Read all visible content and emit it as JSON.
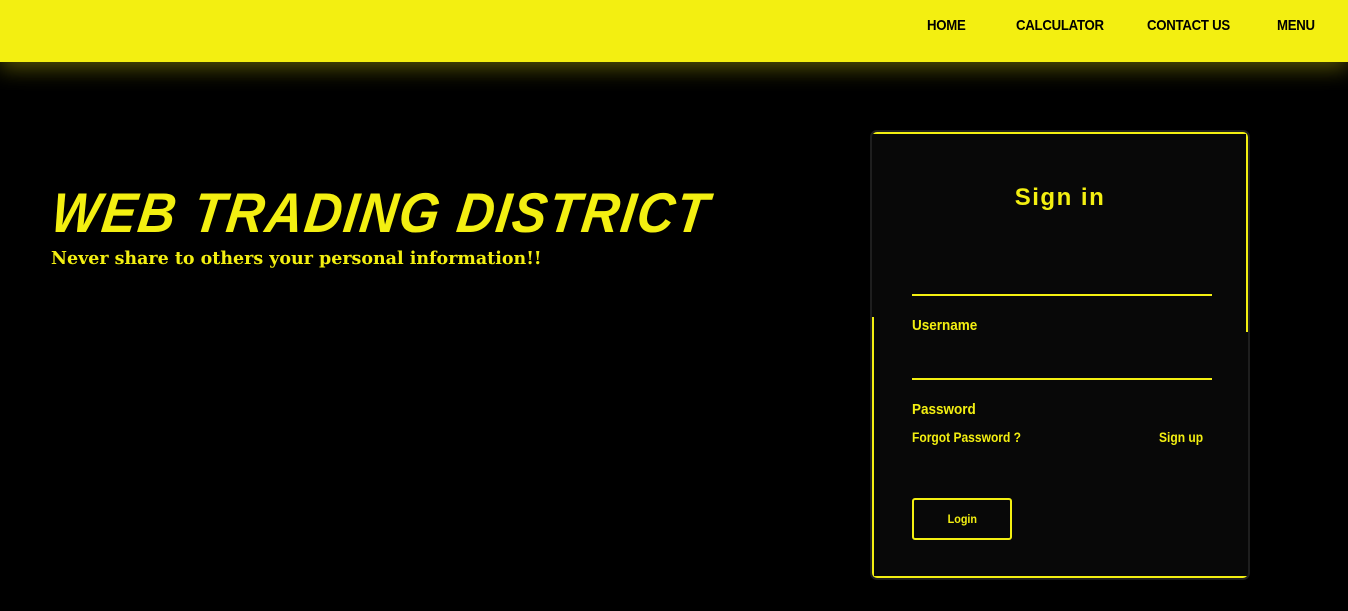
{
  "nav": {
    "items": [
      {
        "label": "HOME"
      },
      {
        "label": "CALCULATOR"
      },
      {
        "label": "CONTACT US"
      },
      {
        "label": "MENU"
      }
    ]
  },
  "hero": {
    "title": "WEB TRADING DISTRICT",
    "subtitle": "Never share to others your personal information!!"
  },
  "signin": {
    "title": "Sign in",
    "username_label": "Username",
    "username_value": "",
    "password_label": "Password",
    "password_value": "",
    "forgot_label": "Forgot Password ?",
    "signup_label": "Sign up",
    "login_label": "Login"
  },
  "colors": {
    "accent": "#f3ef11",
    "background": "#000000",
    "panel": "#080808"
  }
}
